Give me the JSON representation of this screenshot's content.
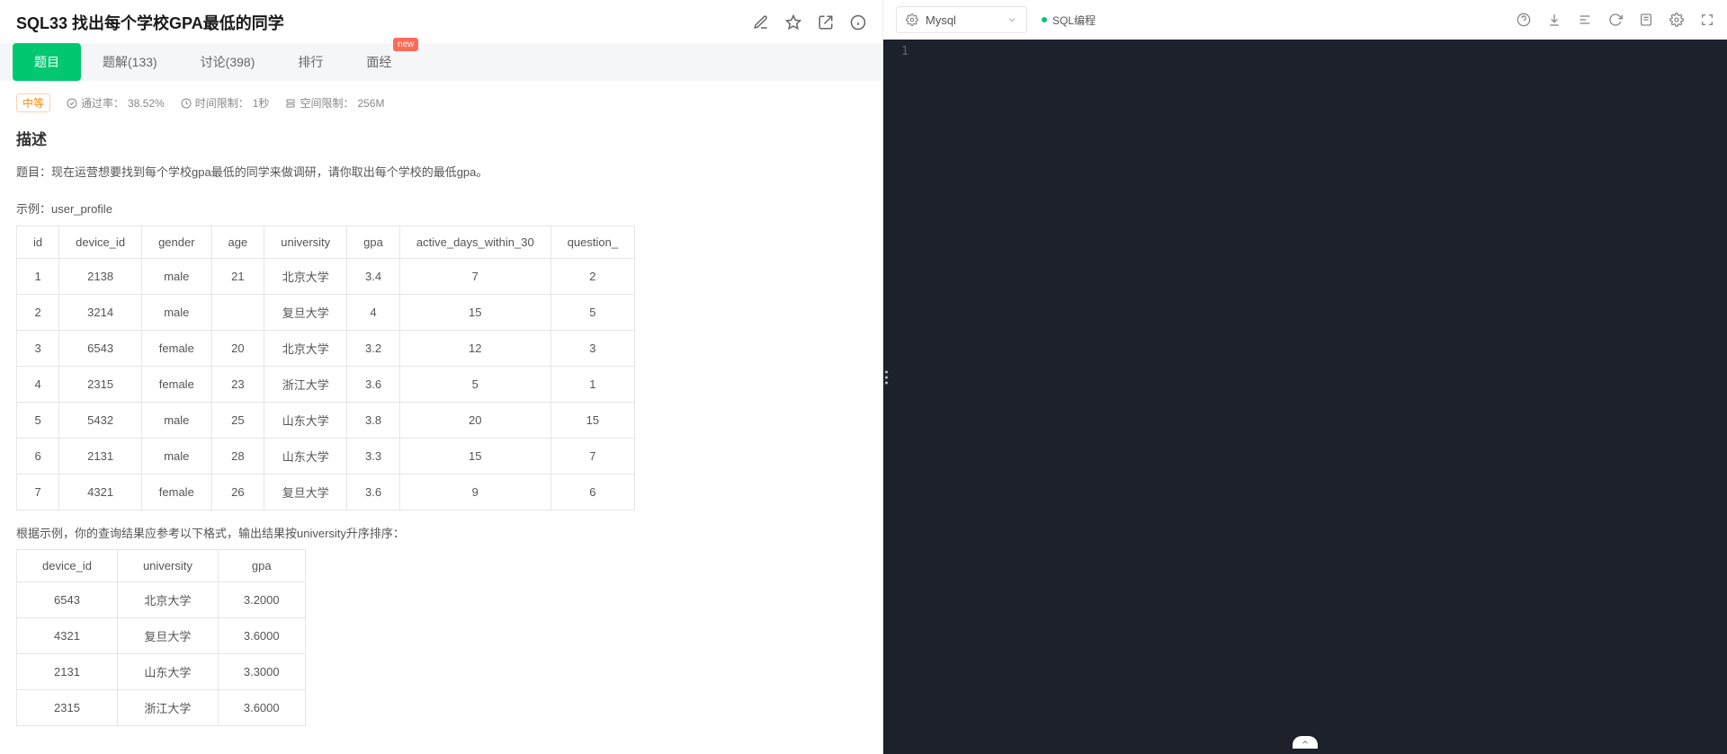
{
  "title": "SQL33  找出每个学校GPA最低的同学",
  "tabs": [
    {
      "label": "题目",
      "active": true
    },
    {
      "label": "题解(133)"
    },
    {
      "label": "讨论(398)"
    },
    {
      "label": "排行"
    },
    {
      "label": "面经",
      "badge": "new"
    }
  ],
  "meta": {
    "difficulty": "中等",
    "pass_label": "通过率：",
    "pass_value": "38.52%",
    "time_label": "时间限制：",
    "time_value": "1秒",
    "space_label": "空间限制：",
    "space_value": "256M"
  },
  "desc_heading": "描述",
  "desc_body": "题目：现在运营想要找到每个学校gpa最低的同学来做调研，请你取出每个学校的最低gpa。",
  "example_label": "示例：user_profile",
  "table1": {
    "headers": [
      "id",
      "device_id",
      "gender",
      "age",
      "university",
      "gpa",
      "active_days_within_30",
      "question_"
    ],
    "rows": [
      [
        "1",
        "2138",
        "male",
        "21",
        "北京大学",
        "3.4",
        "7",
        "2"
      ],
      [
        "2",
        "3214",
        "male",
        "",
        "复旦大学",
        "4",
        "15",
        "5"
      ],
      [
        "3",
        "6543",
        "female",
        "20",
        "北京大学",
        "3.2",
        "12",
        "3"
      ],
      [
        "4",
        "2315",
        "female",
        "23",
        "浙江大学",
        "3.6",
        "5",
        "1"
      ],
      [
        "5",
        "5432",
        "male",
        "25",
        "山东大学",
        "3.8",
        "20",
        "15"
      ],
      [
        "6",
        "2131",
        "male",
        "28",
        "山东大学",
        "3.3",
        "15",
        "7"
      ],
      [
        "7",
        "4321",
        "female",
        "26",
        "复旦大学",
        "3.6",
        "9",
        "6"
      ]
    ]
  },
  "result_hint": "根据示例，你的查询结果应参考以下格式，输出结果按university升序排序：",
  "table2": {
    "headers": [
      "device_id",
      "university",
      "gpa"
    ],
    "rows": [
      [
        "6543",
        "北京大学",
        "3.2000"
      ],
      [
        "4321",
        "复旦大学",
        "3.6000"
      ],
      [
        "2131",
        "山东大学",
        "3.3000"
      ],
      [
        "2315",
        "浙江大学",
        "3.6000"
      ]
    ]
  },
  "right": {
    "language": "Mysql",
    "mode": "SQL编程",
    "line_no": "1"
  }
}
